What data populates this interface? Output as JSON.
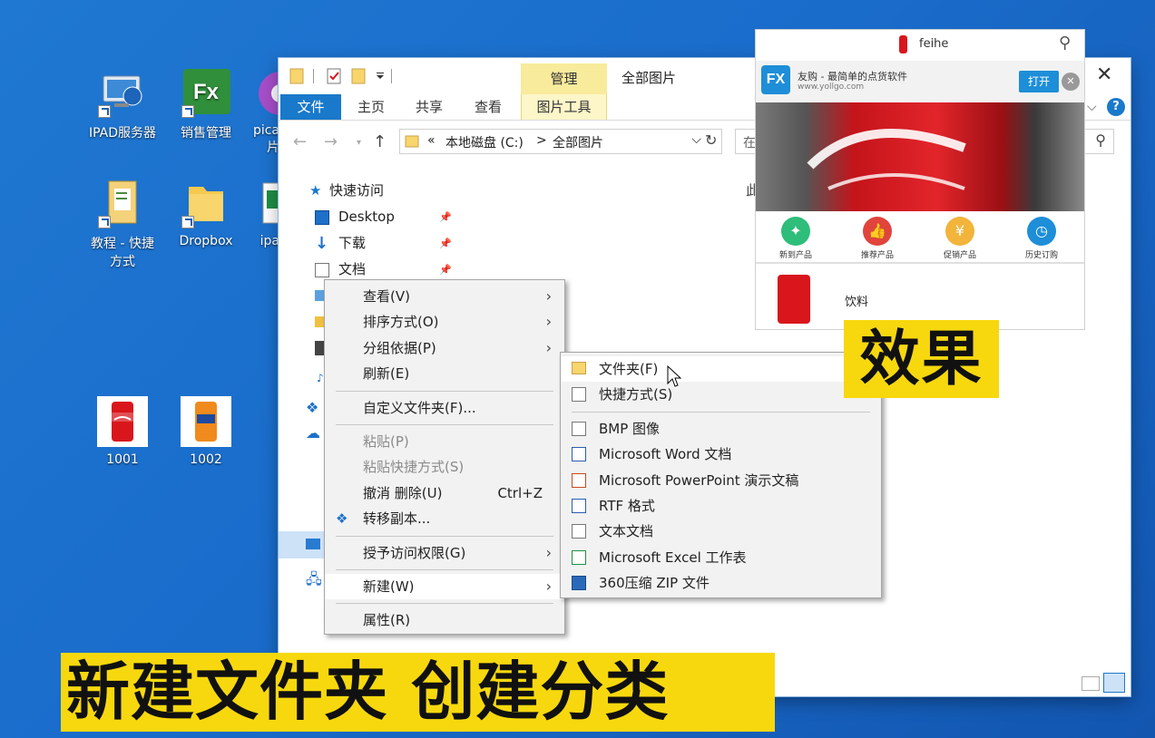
{
  "desktop": {
    "icons": [
      {
        "label": "IPAD服务器",
        "icon": "server-computer-icon"
      },
      {
        "label": "销售管理",
        "icon": "fx-app-icon"
      },
      {
        "label": "pica 片",
        "icon": "picasa-icon"
      },
      {
        "label": "教程 - 快捷方式",
        "icon": "document-folder-icon"
      },
      {
        "label": "Dropbox",
        "icon": "folder-icon"
      },
      {
        "label": "ipa",
        "icon": "excel-file-icon"
      },
      {
        "label": "1001",
        "icon": "coca-cola-can-icon"
      },
      {
        "label": "1002",
        "icon": "fanta-can-icon"
      }
    ]
  },
  "explorer": {
    "manage_tab": "管理",
    "window_title": "全部图片",
    "tabs": {
      "file": "文件",
      "home": "主页",
      "share": "共享",
      "view": "查看",
      "picture_tools": "图片工具"
    },
    "address": {
      "prefix": "«",
      "drive": "本地磁盘 (C:)",
      "sep": ">",
      "folder": "全部图片"
    },
    "search_placeholder": "在",
    "content_hint": "此",
    "nav": {
      "quick_access": "快速访问",
      "items": [
        "Desktop",
        "下载",
        "文档"
      ]
    }
  },
  "context_menu": {
    "items": [
      {
        "label": "查看(V)",
        "submenu": true
      },
      {
        "label": "排序方式(O)",
        "submenu": true
      },
      {
        "label": "分组依据(P)",
        "submenu": true
      },
      {
        "label": "刷新(E)"
      },
      {
        "label": "自定义文件夹(F)..."
      },
      {
        "label": "粘贴(P)",
        "disabled": true
      },
      {
        "label": "粘贴快捷方式(S)",
        "disabled": true
      },
      {
        "label": "撤消 删除(U)",
        "shortcut": "Ctrl+Z"
      },
      {
        "label": "转移副本..."
      },
      {
        "label": "授予访问权限(G)",
        "submenu": true
      },
      {
        "label": "新建(W)",
        "submenu": true
      },
      {
        "label": "属性(R)"
      }
    ]
  },
  "new_submenu": {
    "items": [
      {
        "label": "文件夹(F)",
        "icon": "folder-icon"
      },
      {
        "label": "快捷方式(S)",
        "icon": "shortcut-icon"
      },
      {
        "label": "BMP 图像",
        "icon": "bmp-file-icon"
      },
      {
        "label": "Microsoft Word 文档",
        "icon": "word-file-icon"
      },
      {
        "label": "Microsoft PowerPoint 演示文稿",
        "icon": "powerpoint-file-icon"
      },
      {
        "label": "RTF 格式",
        "icon": "rtf-file-icon"
      },
      {
        "label": "文本文档",
        "icon": "text-file-icon"
      },
      {
        "label": "Microsoft Excel 工作表",
        "icon": "excel-file-icon"
      },
      {
        "label": "360压缩 ZIP 文件",
        "icon": "zip-file-icon"
      }
    ]
  },
  "app_popup": {
    "search_value": "feihe",
    "ad_title": "友购 - 最简单的点货软件",
    "ad_url": "www.yollgo.com",
    "open_label": "打开",
    "categories": [
      "新到产品",
      "推荐产品",
      "促销产品",
      "历史订购"
    ],
    "product_label": "饮料"
  },
  "overlay": {
    "effect": "效果",
    "banner": "新建文件夹 创建分类"
  },
  "colors": {
    "accent": "#1979ca",
    "highlight_yellow": "#f7d80e",
    "desktop_blue": "#1a6ccb"
  }
}
